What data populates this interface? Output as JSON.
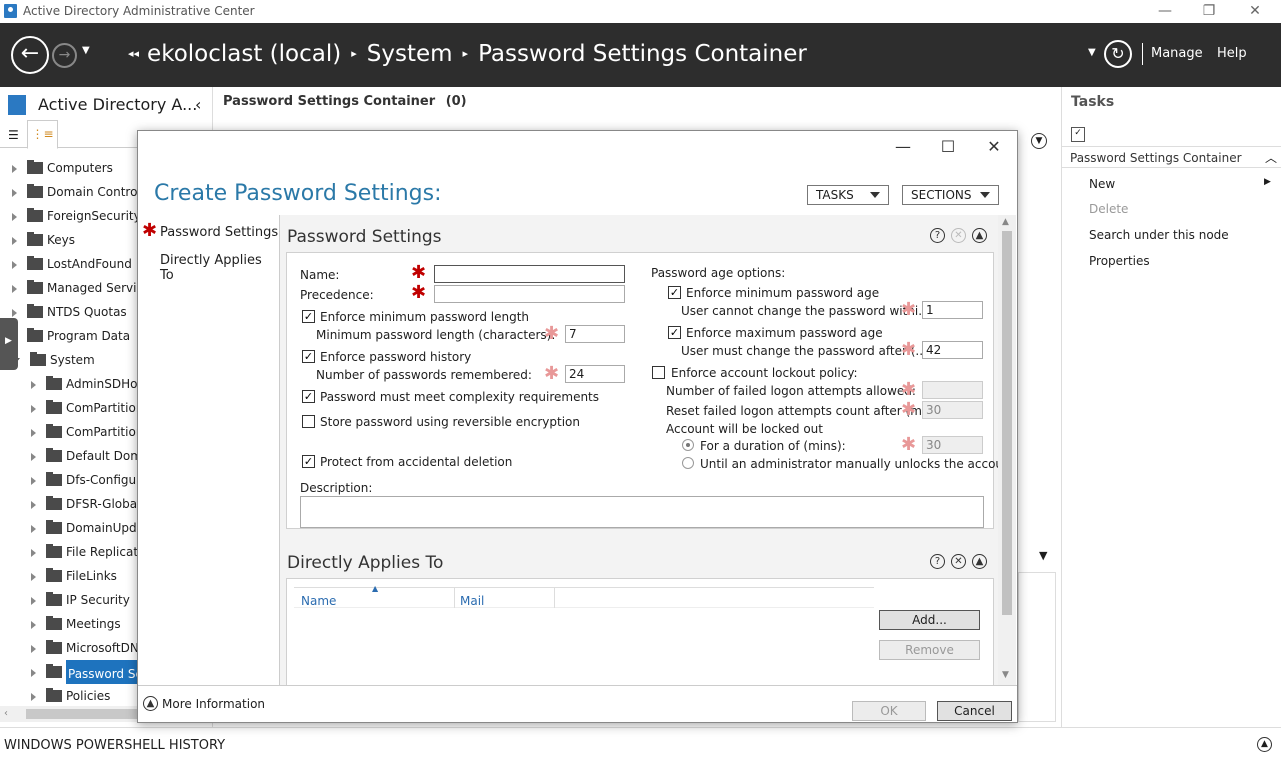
{
  "window": {
    "title": "Active Directory Administrative Center"
  },
  "breadcrumb": {
    "items": [
      "ekoloclast (local)",
      "System",
      "Password Settings Container"
    ]
  },
  "nav": {
    "manage": "Manage",
    "help": "Help"
  },
  "left": {
    "title": "Active Directory A...",
    "tree": [
      {
        "label": "Computers",
        "indent": 0
      },
      {
        "label": "Domain Controllers",
        "indent": 0
      },
      {
        "label": "ForeignSecurityPrincipals",
        "indent": 0
      },
      {
        "label": "Keys",
        "indent": 0
      },
      {
        "label": "LostAndFound",
        "indent": 0
      },
      {
        "label": "Managed Service Accounts",
        "indent": 0
      },
      {
        "label": "NTDS Quotas",
        "indent": 0
      },
      {
        "label": "Program Data",
        "indent": 0
      },
      {
        "label": "System",
        "indent": 0
      },
      {
        "label": "AdminSDHolder",
        "indent": 1
      },
      {
        "label": "ComPartitions",
        "indent": 1
      },
      {
        "label": "ComPartitionSets",
        "indent": 1
      },
      {
        "label": "Default Domain Policy",
        "indent": 1
      },
      {
        "label": "Dfs-Configuration",
        "indent": 1
      },
      {
        "label": "DFSR-GlobalSettings",
        "indent": 1
      },
      {
        "label": "DomainUpdates",
        "indent": 1
      },
      {
        "label": "File Replication Service",
        "indent": 1
      },
      {
        "label": "FileLinks",
        "indent": 1
      },
      {
        "label": "IP Security",
        "indent": 1
      },
      {
        "label": "Meetings",
        "indent": 1
      },
      {
        "label": "MicrosoftDNS",
        "indent": 1
      },
      {
        "label": "Password Settings Container",
        "indent": 1,
        "selected": true
      },
      {
        "label": "Policies",
        "indent": 1
      }
    ]
  },
  "center": {
    "header": "Password Settings Container",
    "count": "(0)"
  },
  "tasks": {
    "title": "Tasks",
    "section": "Password Settings Container",
    "items": [
      "New",
      "Delete",
      "Search under this node",
      "Properties"
    ]
  },
  "footer": {
    "ps_history": "WINDOWS POWERSHELL HISTORY"
  },
  "dialog": {
    "title": "Create Password Settings:",
    "tasks_btn": "TASKS",
    "sections_btn": "SECTIONS",
    "nav": [
      "Password Settings",
      "Directly Applies To"
    ],
    "password_settings": {
      "header": "Password Settings",
      "name_label": "Name:",
      "name_value": "",
      "precedence_label": "Precedence:",
      "precedence_value": "",
      "enforce_min_len": "Enforce minimum password length",
      "min_len_label": "Minimum password length (characters):",
      "min_len_value": "7",
      "enforce_history": "Enforce password history",
      "history_label": "Number of passwords remembered:",
      "history_value": "24",
      "complexity": "Password must meet complexity requirements",
      "reversible": "Store password using reversible encryption",
      "protect": "Protect from accidental deletion",
      "age_options": "Password age options:",
      "enforce_min_age": "Enforce minimum password age",
      "min_age_label": "User cannot change the password withi...",
      "min_age_value": "1",
      "enforce_max_age": "Enforce maximum password age",
      "max_age_label": "User must change the password after (...",
      "max_age_value": "42",
      "lockout": "Enforce account lockout policy:",
      "failed_attempts": "Number of failed logon attempts allowed:",
      "failed_value": "",
      "reset_count": "Reset failed logon attempts count after (m...",
      "reset_value": "30",
      "locked_out": "Account will be locked out",
      "for_duration": "For a duration of (mins):",
      "duration_value": "30",
      "until_admin": "Until an administrator manually unlocks the account",
      "description": "Description:"
    },
    "applies": {
      "header": "Directly Applies To",
      "col_name": "Name",
      "col_mail": "Mail",
      "add": "Add...",
      "remove": "Remove"
    },
    "more_info": "More Information",
    "ok": "OK",
    "cancel": "Cancel"
  }
}
